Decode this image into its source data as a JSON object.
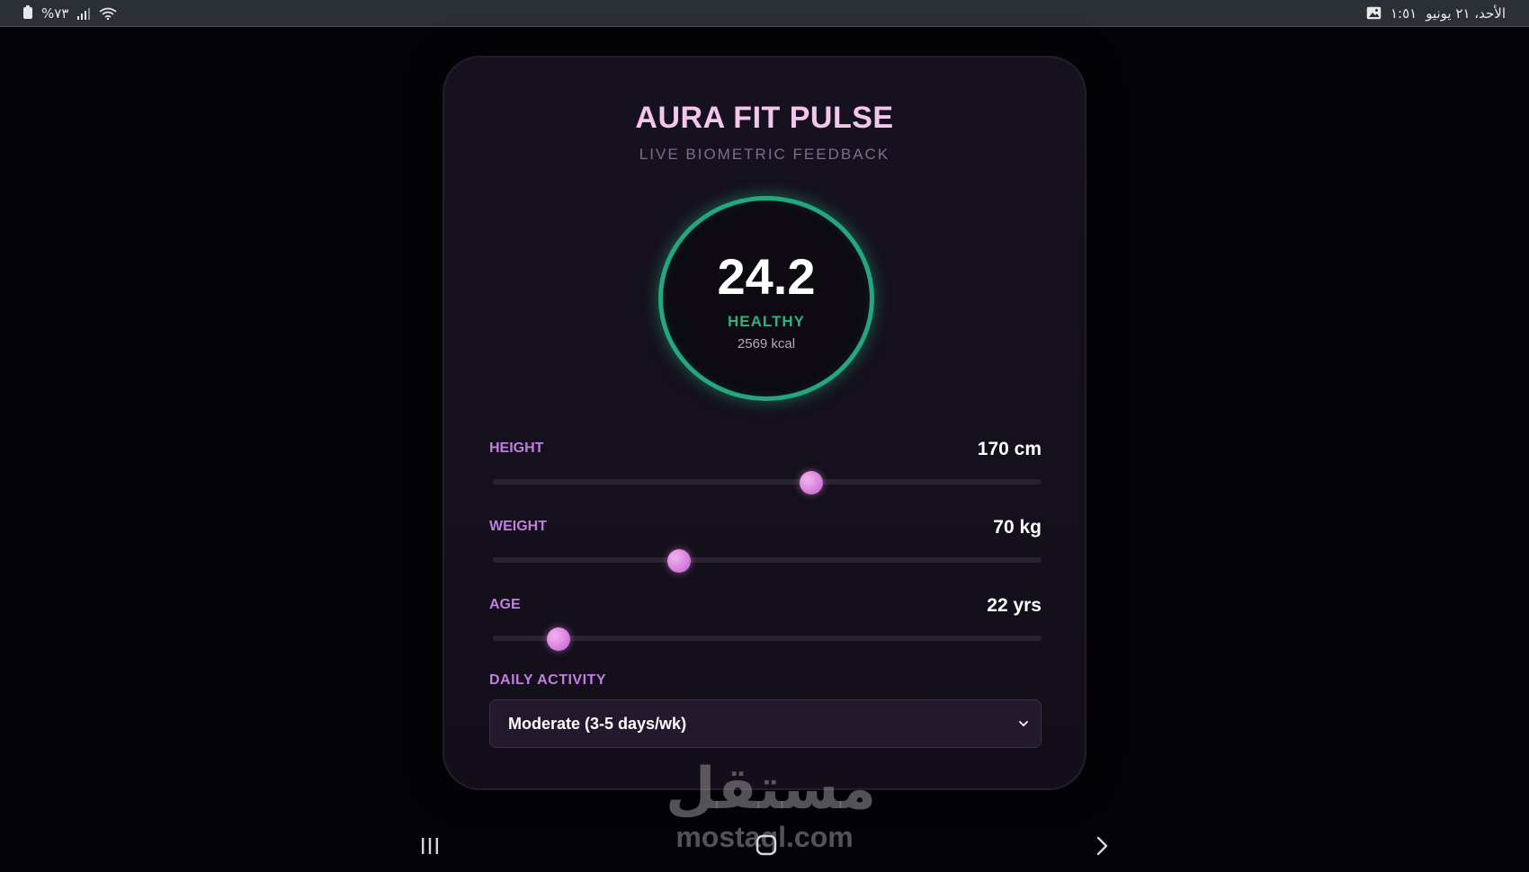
{
  "status_bar": {
    "battery_text": "%٧٣",
    "date_text": "الأحد، ٢١ يونيو",
    "time_text": "١:٥١"
  },
  "app": {
    "title": "AURA FIT PULSE",
    "subtitle": "LIVE BIOMETRIC FEEDBACK"
  },
  "gauge": {
    "value": "24.2",
    "status": "HEALTHY",
    "calories": "2569 kcal",
    "color": "#24a77d"
  },
  "sliders": [
    {
      "label": "HEIGHT",
      "value": "170 cm",
      "fraction": 0.58
    },
    {
      "label": "WEIGHT",
      "value": "70 kg",
      "fraction": 0.34
    },
    {
      "label": "AGE",
      "value": "22 yrs",
      "fraction": 0.12
    }
  ],
  "activity": {
    "label": "DAILY ACTIVITY",
    "selected": "Moderate (3-5 days/wk)"
  },
  "watermark": {
    "arabic": "مستقل",
    "latin": "mostaql.com"
  },
  "colors": {
    "accent": "#c07fe0",
    "title": "#f4c6ec",
    "healthy": "#2fb07f"
  }
}
